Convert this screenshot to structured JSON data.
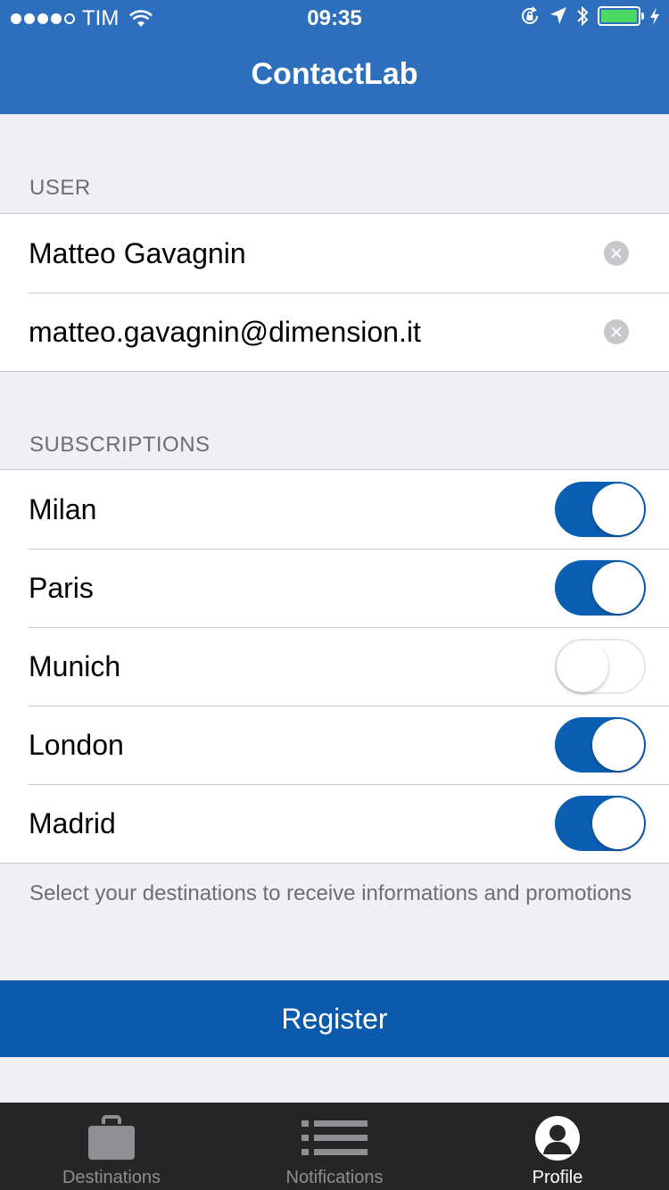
{
  "status_bar": {
    "carrier": "TIM",
    "time": "09:35"
  },
  "nav": {
    "title": "ContactLab"
  },
  "user_section": {
    "header": "USER",
    "name_value": "Matteo Gavagnin",
    "email_value": "matteo.gavagnin@dimension.it"
  },
  "subscriptions_section": {
    "header": "SUBSCRIPTIONS",
    "items": [
      {
        "label": "Milan",
        "enabled": true
      },
      {
        "label": "Paris",
        "enabled": true
      },
      {
        "label": "Munich",
        "enabled": false
      },
      {
        "label": "London",
        "enabled": true
      },
      {
        "label": "Madrid",
        "enabled": true
      }
    ],
    "footer": "Select your destinations to receive informations and promotions"
  },
  "register_label": "Register",
  "tabbar": {
    "tabs": [
      {
        "label": "Destinations",
        "icon": "briefcase-icon",
        "active": false
      },
      {
        "label": "Notifications",
        "icon": "list-icon",
        "active": false
      },
      {
        "label": "Profile",
        "icon": "profile-icon",
        "active": true
      }
    ]
  },
  "colors": {
    "nav_bar": "#2d6fbd",
    "accent": "#0b5aae",
    "battery": "#4cd964",
    "tabbar": "#262626"
  }
}
